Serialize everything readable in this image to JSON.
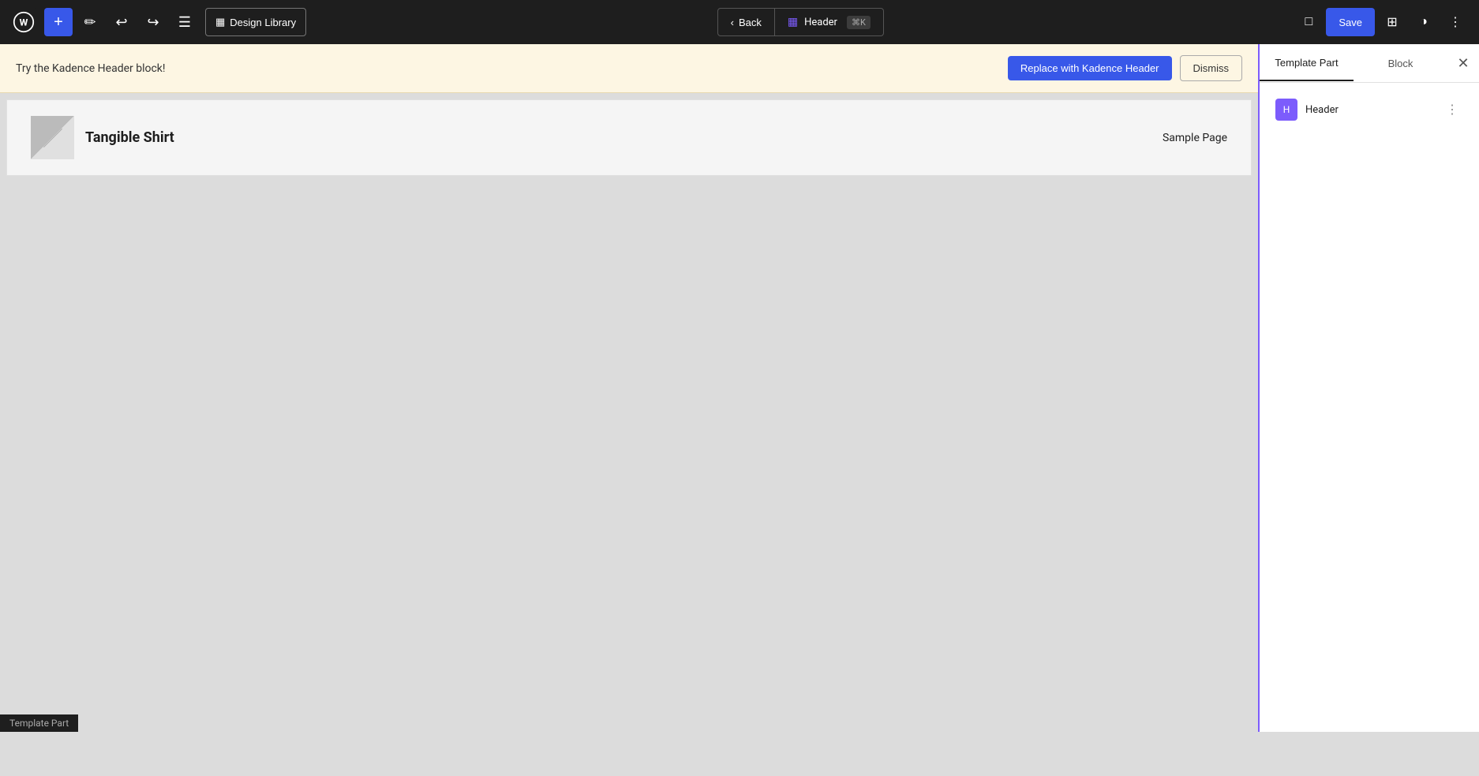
{
  "toolbar": {
    "add_label": "+",
    "undo_label": "↩",
    "redo_label": "↪",
    "hamburger_label": "☰",
    "design_library_label": "Design Library",
    "design_library_icon": "▦",
    "back_label": "Back",
    "header_label": "Header",
    "header_shortcut": "⌘K",
    "save_label": "Save",
    "view_icon": "□",
    "layout_icon": "⊞",
    "contrast_icon": "◑",
    "options_icon": "⋮"
  },
  "notice": {
    "text": "Try the Kadence Header block!",
    "replace_btn": "Replace with Kadence Header",
    "dismiss_btn": "Dismiss"
  },
  "header_preview": {
    "site_name": "Tangible Shirt",
    "nav_link": "Sample Page"
  },
  "sidebar": {
    "tab_template_part": "Template Part",
    "tab_block": "Block",
    "block_item_label": "Header",
    "block_item_icon": "H"
  },
  "status_bar": {
    "text": "Template Part"
  },
  "colors": {
    "accent": "#3858e9",
    "purple": "#7c5cfc",
    "toolbar_bg": "#1e1e1e"
  }
}
